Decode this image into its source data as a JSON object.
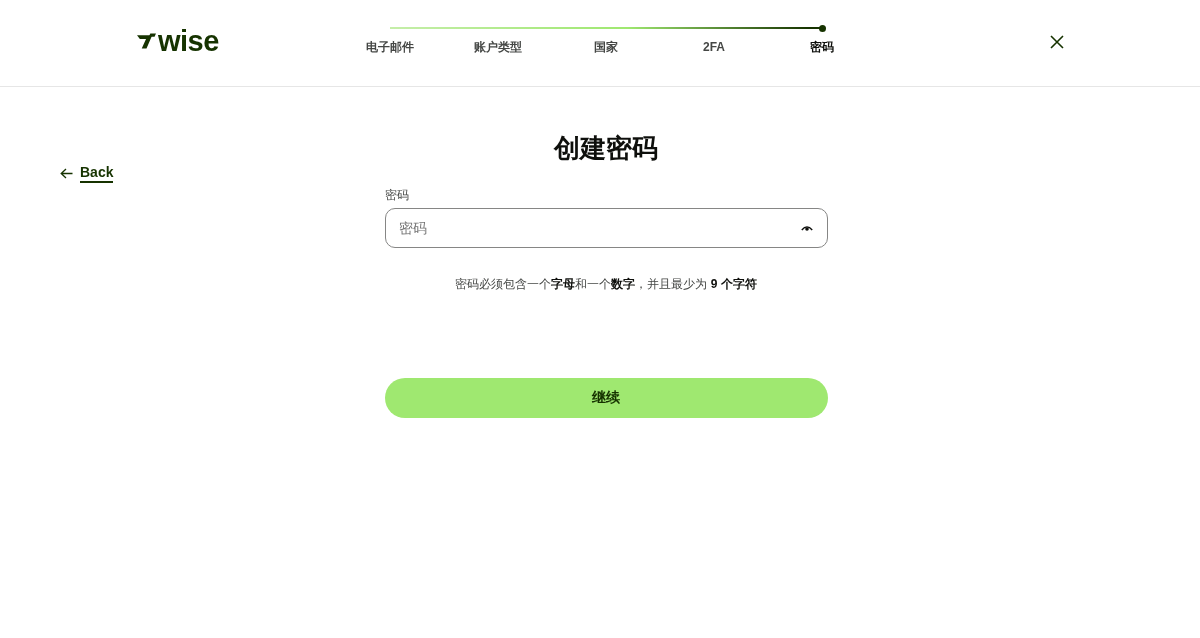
{
  "header": {
    "logo": "wise",
    "steps": [
      {
        "label": "电子邮件",
        "selected": false
      },
      {
        "label": "账户类型",
        "selected": false
      },
      {
        "label": "国家",
        "selected": false
      },
      {
        "label": "2FA",
        "selected": false
      },
      {
        "label": "密码",
        "selected": true
      }
    ]
  },
  "back_link": "Back",
  "title": "创建密码",
  "password_field": {
    "label": "密码",
    "placeholder": "密码"
  },
  "hint": "密码必须包含一个**字母**和一个**数字**，并且最少为 **9 个字符**",
  "continue_button": "继续"
}
